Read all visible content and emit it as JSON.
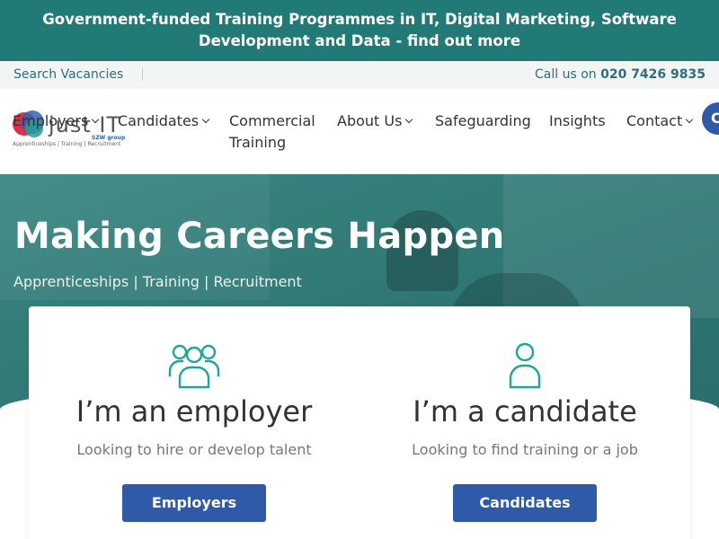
{
  "promo": {
    "text": "Government-funded Training Programmes in IT, Digital Marketing, Software Development and Data - find out more"
  },
  "utility": {
    "search_vacancies": "Search Vacancies",
    "call_prefix": "Call us on ",
    "phone": "020 7426 9835"
  },
  "logo": {
    "name": "just IT",
    "tagline": "Apprenticeships | Training | Recruitment",
    "group": "SZW group"
  },
  "nav": {
    "employers": "Employers",
    "candidates": "Candidates",
    "commercial_training": "Commercial Training",
    "about_us": "About Us",
    "safeguarding": "Safeguarding",
    "insights": "Insights",
    "contact": "Contact",
    "cta_partial": "C"
  },
  "hero": {
    "title": "Making Careers Happen",
    "subtitle": "Apprenticeships | Training | Recruitment"
  },
  "choices": {
    "employer": {
      "title": "I’m an employer",
      "description": "Looking to hire or develop talent",
      "button": "Employers",
      "icon": "group-icon"
    },
    "candidate": {
      "title": "I’m a candidate",
      "description": "Looking to find training or a job",
      "button": "Candidates",
      "icon": "person-icon"
    }
  },
  "colors": {
    "brand_teal": "#217a76",
    "button_blue": "#2e5aa8",
    "icon_teal": "#1fa59a"
  }
}
